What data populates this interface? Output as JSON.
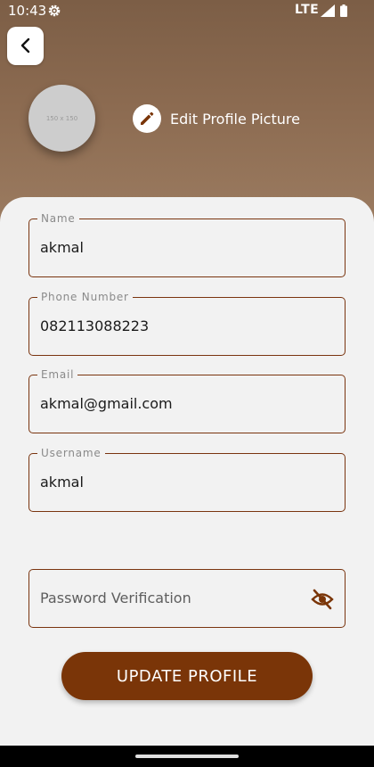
{
  "status_bar": {
    "time": "10:43",
    "network": "LTE",
    "icons": [
      "gear-icon",
      "signal-icon",
      "battery-icon"
    ]
  },
  "header": {
    "back_icon": "chevron-left-icon",
    "avatar_placeholder": "150 x 150",
    "edit_picture_label": "Edit Profile Picture",
    "edit_picture_icon": "pencil-icon"
  },
  "form": {
    "name": {
      "label": "Name",
      "value": "akmal"
    },
    "phone": {
      "label": "Phone Number",
      "value": "082113088223"
    },
    "email": {
      "label": "Email",
      "value": "akmal@gmail.com"
    },
    "username": {
      "label": "Username",
      "value": "akmal"
    },
    "password": {
      "placeholder": "Password Verification",
      "toggle_icon": "eye-off-icon"
    }
  },
  "actions": {
    "update_label": "UPDATE PROFILE"
  },
  "colors": {
    "header_brown": "#8c6a50",
    "accent": "#7a3508",
    "card_background": "#f2f2f2"
  }
}
